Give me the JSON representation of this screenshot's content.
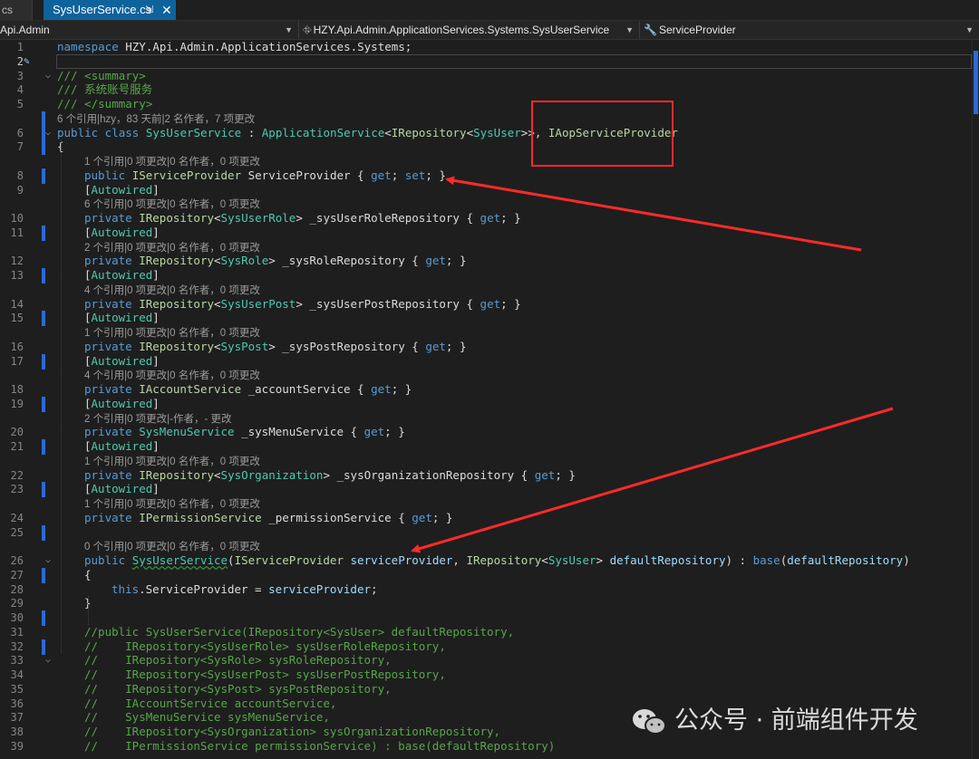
{
  "tabs": {
    "prev_label": "cs",
    "active_label": "SysUserService.cs",
    "pin_glyph": "⇲",
    "close_glyph": "✕"
  },
  "navbar": {
    "project": "Api.Admin",
    "class_scope": "HZY.Api.Admin.ApplicationServices.Systems.SysUserService",
    "member_scope": "ServiceProvider"
  },
  "highlight": {
    "box_color": "#ff2a2a",
    "arrow_color": "#ff2a2a"
  },
  "watermark": {
    "text": "公众号 · 前端组件开发"
  },
  "code": {
    "lines": [
      {
        "ln": "1",
        "parts": [
          [
            "kw",
            "namespace"
          ],
          [
            "pr",
            " HZY.Api.Admin.ApplicationServices.Systems;"
          ]
        ]
      },
      {
        "ln": "2",
        "parts": [],
        "current": true
      },
      {
        "ln": "3",
        "parts": [
          [
            "cm",
            "/// <summary>"
          ]
        ]
      },
      {
        "ln": "4",
        "parts": [
          [
            "cm",
            "/// 系统账号服务"
          ]
        ]
      },
      {
        "ln": "5",
        "parts": [
          [
            "cm",
            "/// </summary>"
          ]
        ]
      },
      {
        "lens": "6 个引用|hzy，83 天前|2 名作者，7 项更改"
      },
      {
        "ln": "6",
        "parts": [
          [
            "kw",
            "public class"
          ],
          [
            "pr",
            " "
          ],
          [
            "ty",
            "SysUserService"
          ],
          [
            "pr",
            " : "
          ],
          [
            "ty",
            "ApplicationService"
          ],
          [
            "pr",
            "<"
          ],
          [
            "ty2",
            "IRepository"
          ],
          [
            "pr",
            "<"
          ],
          [
            "ty",
            "SysUser"
          ],
          [
            "pr",
            ">>, "
          ],
          [
            "ty2",
            "IAopServiceProvider"
          ]
        ]
      },
      {
        "ln": "7",
        "parts": [
          [
            "pr",
            "{"
          ]
        ]
      },
      {
        "lens": "1 个引用|0 项更改|0 名作者，0 项更改",
        "indent": 4
      },
      {
        "ln": "8",
        "indent": 4,
        "parts": [
          [
            "kw",
            "public"
          ],
          [
            "pr",
            " "
          ],
          [
            "ty2",
            "IServiceProvider"
          ],
          [
            "pr",
            " ServiceProvider { "
          ],
          [
            "kw",
            "get"
          ],
          [
            "pr",
            "; "
          ],
          [
            "kw",
            "set"
          ],
          [
            "pr",
            "; }"
          ]
        ]
      },
      {
        "ln": "9",
        "indent": 4,
        "parts": [
          [
            "pr",
            "["
          ],
          [
            "an",
            "Autowired"
          ],
          [
            "pr",
            "]"
          ]
        ]
      },
      {
        "lens": "6 个引用|0 项更改|0 名作者，0 项更改",
        "indent": 4
      },
      {
        "ln": "10",
        "indent": 4,
        "parts": [
          [
            "kw",
            "private"
          ],
          [
            "pr",
            " "
          ],
          [
            "ty2",
            "IRepository"
          ],
          [
            "pr",
            "<"
          ],
          [
            "ty",
            "SysUserRole"
          ],
          [
            "pr",
            "> _sysUserRoleRepository { "
          ],
          [
            "kw",
            "get"
          ],
          [
            "pr",
            "; }"
          ]
        ]
      },
      {
        "ln": "11",
        "indent": 4,
        "parts": [
          [
            "pr",
            "["
          ],
          [
            "an",
            "Autowired"
          ],
          [
            "pr",
            "]"
          ]
        ]
      },
      {
        "lens": "2 个引用|0 项更改|0 名作者，0 项更改",
        "indent": 4
      },
      {
        "ln": "12",
        "indent": 4,
        "parts": [
          [
            "kw",
            "private"
          ],
          [
            "pr",
            " "
          ],
          [
            "ty2",
            "IRepository"
          ],
          [
            "pr",
            "<"
          ],
          [
            "ty",
            "SysRole"
          ],
          [
            "pr",
            "> _sysRoleRepository { "
          ],
          [
            "kw",
            "get"
          ],
          [
            "pr",
            "; }"
          ]
        ]
      },
      {
        "ln": "13",
        "indent": 4,
        "parts": [
          [
            "pr",
            "["
          ],
          [
            "an",
            "Autowired"
          ],
          [
            "pr",
            "]"
          ]
        ]
      },
      {
        "lens": "4 个引用|0 项更改|0 名作者，0 项更改",
        "indent": 4
      },
      {
        "ln": "14",
        "indent": 4,
        "parts": [
          [
            "kw",
            "private"
          ],
          [
            "pr",
            " "
          ],
          [
            "ty2",
            "IRepository"
          ],
          [
            "pr",
            "<"
          ],
          [
            "ty",
            "SysUserPost"
          ],
          [
            "pr",
            "> _sysUserPostRepository { "
          ],
          [
            "kw",
            "get"
          ],
          [
            "pr",
            "; }"
          ]
        ]
      },
      {
        "ln": "15",
        "indent": 4,
        "parts": [
          [
            "pr",
            "["
          ],
          [
            "an",
            "Autowired"
          ],
          [
            "pr",
            "]"
          ]
        ]
      },
      {
        "lens": "1 个引用|0 项更改|0 名作者，0 项更改",
        "indent": 4
      },
      {
        "ln": "16",
        "indent": 4,
        "parts": [
          [
            "kw",
            "private"
          ],
          [
            "pr",
            " "
          ],
          [
            "ty2",
            "IRepository"
          ],
          [
            "pr",
            "<"
          ],
          [
            "ty",
            "SysPost"
          ],
          [
            "pr",
            "> _sysPostRepository { "
          ],
          [
            "kw",
            "get"
          ],
          [
            "pr",
            "; }"
          ]
        ]
      },
      {
        "ln": "17",
        "indent": 4,
        "parts": [
          [
            "pr",
            "["
          ],
          [
            "an",
            "Autowired"
          ],
          [
            "pr",
            "]"
          ]
        ]
      },
      {
        "lens": "4 个引用|0 项更改|0 名作者，0 项更改",
        "indent": 4
      },
      {
        "ln": "18",
        "indent": 4,
        "parts": [
          [
            "kw",
            "private"
          ],
          [
            "pr",
            " "
          ],
          [
            "ty2",
            "IAccountService"
          ],
          [
            "pr",
            " _accountService { "
          ],
          [
            "kw",
            "get"
          ],
          [
            "pr",
            "; }"
          ]
        ]
      },
      {
        "ln": "19",
        "indent": 4,
        "parts": [
          [
            "pr",
            "["
          ],
          [
            "an",
            "Autowired"
          ],
          [
            "pr",
            "]"
          ]
        ]
      },
      {
        "lens": "2 个引用|0 项更改|-作者，- 更改",
        "indent": 4
      },
      {
        "ln": "20",
        "indent": 4,
        "parts": [
          [
            "kw",
            "private"
          ],
          [
            "pr",
            " "
          ],
          [
            "ty",
            "SysMenuService"
          ],
          [
            "pr",
            " _sysMenuService { "
          ],
          [
            "kw",
            "get"
          ],
          [
            "pr",
            "; }"
          ]
        ]
      },
      {
        "ln": "21",
        "indent": 4,
        "parts": [
          [
            "pr",
            "["
          ],
          [
            "an",
            "Autowired"
          ],
          [
            "pr",
            "]"
          ]
        ]
      },
      {
        "lens": "1 个引用|0 项更改|0 名作者，0 项更改",
        "indent": 4
      },
      {
        "ln": "22",
        "indent": 4,
        "parts": [
          [
            "kw",
            "private"
          ],
          [
            "pr",
            " "
          ],
          [
            "ty2",
            "IRepository"
          ],
          [
            "pr",
            "<"
          ],
          [
            "ty",
            "SysOrganization"
          ],
          [
            "pr",
            "> _sysOrganizationRepository { "
          ],
          [
            "kw",
            "get"
          ],
          [
            "pr",
            "; }"
          ]
        ]
      },
      {
        "ln": "23",
        "indent": 4,
        "parts": [
          [
            "pr",
            "["
          ],
          [
            "an",
            "Autowired"
          ],
          [
            "pr",
            "]"
          ]
        ]
      },
      {
        "lens": "1 个引用|0 项更改|0 名作者，0 项更改",
        "indent": 4
      },
      {
        "ln": "24",
        "indent": 4,
        "parts": [
          [
            "kw",
            "private"
          ],
          [
            "pr",
            " "
          ],
          [
            "ty2",
            "IPermissionService"
          ],
          [
            "pr",
            " _permissionService { "
          ],
          [
            "kw",
            "get"
          ],
          [
            "pr",
            "; }"
          ]
        ]
      },
      {
        "ln": "25",
        "parts": []
      },
      {
        "lens": "0 个引用|0 项更改|0 名作者，0 项更改",
        "indent": 4
      },
      {
        "ln": "26",
        "indent": 4,
        "parts": [
          [
            "kw",
            "public"
          ],
          [
            "pr",
            " "
          ],
          [
            "tysq",
            "SysUserService"
          ],
          [
            "pr",
            "("
          ],
          [
            "ty2",
            "IServiceProvider"
          ],
          [
            "pr",
            " "
          ],
          [
            "pa",
            "serviceProvider"
          ],
          [
            "pr",
            ", "
          ],
          [
            "ty2",
            "IRepository"
          ],
          [
            "pr",
            "<"
          ],
          [
            "ty",
            "SysUser"
          ],
          [
            "pr",
            "> "
          ],
          [
            "pa",
            "defaultRepository"
          ],
          [
            "pr",
            ") : "
          ],
          [
            "kw",
            "base"
          ],
          [
            "pr",
            "("
          ],
          [
            "pa",
            "defaultRepository"
          ],
          [
            "pr",
            ")"
          ]
        ]
      },
      {
        "ln": "27",
        "indent": 4,
        "parts": [
          [
            "pr",
            "{"
          ]
        ]
      },
      {
        "ln": "28",
        "indent": 8,
        "parts": [
          [
            "kw",
            "this"
          ],
          [
            "pr",
            ".ServiceProvider = "
          ],
          [
            "pa",
            "serviceProvider"
          ],
          [
            "pr",
            ";"
          ]
        ]
      },
      {
        "ln": "29",
        "indent": 4,
        "parts": [
          [
            "pr",
            "}"
          ]
        ]
      },
      {
        "ln": "30",
        "parts": []
      },
      {
        "ln": "31",
        "indent": 4,
        "parts": [
          [
            "cm",
            "//public SysUserService(IRepository<SysUser> defaultRepository,"
          ]
        ]
      },
      {
        "ln": "32",
        "indent": 4,
        "parts": [
          [
            "cm",
            "//    IRepository<SysUserRole> sysUserRoleRepository,"
          ]
        ]
      },
      {
        "ln": "33",
        "indent": 4,
        "parts": [
          [
            "cm",
            "//    IRepository<SysRole> sysRoleRepository,"
          ]
        ]
      },
      {
        "ln": "34",
        "indent": 4,
        "parts": [
          [
            "cm",
            "//    IRepository<SysUserPost> sysUserPostRepository,"
          ]
        ]
      },
      {
        "ln": "35",
        "indent": 4,
        "parts": [
          [
            "cm",
            "//    IRepository<SysPost> sysPostRepository,"
          ]
        ]
      },
      {
        "ln": "36",
        "indent": 4,
        "parts": [
          [
            "cm",
            "//    IAccountService accountService,"
          ]
        ]
      },
      {
        "ln": "37",
        "indent": 4,
        "parts": [
          [
            "cm",
            "//    SysMenuService sysMenuService,"
          ]
        ]
      },
      {
        "ln": "38",
        "indent": 4,
        "parts": [
          [
            "cm",
            "//    IRepository<SysOrganization> sysOrganizationRepository,"
          ]
        ]
      },
      {
        "ln": "39",
        "indent": 4,
        "parts": [
          [
            "cm",
            "//    IPermissionService permissionService) : base(defaultRepository)"
          ]
        ]
      }
    ]
  }
}
